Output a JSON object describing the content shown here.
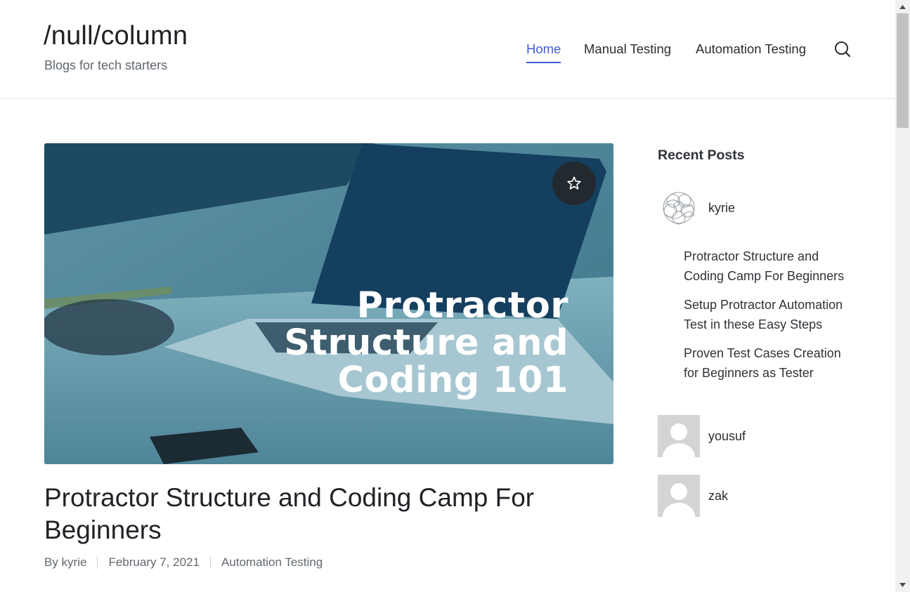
{
  "site": {
    "title": "/null/column",
    "tagline": "Blogs for tech starters"
  },
  "nav": {
    "items": [
      {
        "label": "Home",
        "active": true
      },
      {
        "label": "Manual Testing",
        "active": false
      },
      {
        "label": "Automation Testing",
        "active": false
      }
    ],
    "search_icon": "search-icon"
  },
  "featured_image": {
    "headline_lines": [
      "Protractor",
      "Structure and",
      "Coding 101"
    ],
    "badge_icon": "star-icon"
  },
  "post": {
    "title": "Protractor Structure and Coding Camp For Beginners",
    "author": "By kyrie",
    "date": "February 7, 2021",
    "category": "Automation Testing"
  },
  "sidebar": {
    "widget_title": "Recent Posts",
    "authors": [
      {
        "name": "kyrie",
        "posts": [
          "Protractor Structure and Coding Camp For Beginners",
          "Setup Protractor Automation Test in these Easy Steps",
          "Proven Test Cases Creation for Beginners as Tester"
        ]
      },
      {
        "name": "yousuf",
        "posts": []
      },
      {
        "name": "zak",
        "posts": []
      }
    ]
  },
  "colors": {
    "accent": "#3f5bd1",
    "text": "#2a2d31",
    "muted": "#62686f"
  }
}
